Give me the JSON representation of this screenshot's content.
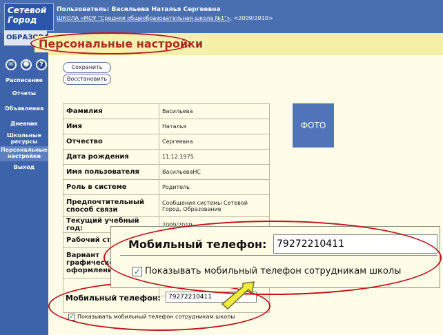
{
  "header": {
    "logo_line1": "Сетевой",
    "logo_line2": "Город",
    "logo_strip": "ОБРАЗОВАНИЕ",
    "user": "Пользователь: Васильева Наталья Сергеевна",
    "school": "ШКОЛА «МОУ \"Средняя общеобразовательная школа №1\"»",
    "year": ", <2009/2010>"
  },
  "page": {
    "title": "Персональные настройки"
  },
  "sidebar": {
    "icons": [
      "mail-icon",
      "users-icon",
      "help-icon"
    ],
    "items": [
      {
        "label": "Расписание"
      },
      {
        "label": "Отчеты"
      },
      {
        "label": "Объявления"
      },
      {
        "label": "Дневник"
      },
      {
        "label": "Школьные ресурсы"
      },
      {
        "label": "Персональные настройки"
      },
      {
        "label": "Выход"
      }
    ]
  },
  "toolbar": {
    "save_label": "Сохранить",
    "restore_label": "Восстановить"
  },
  "form": {
    "rows": [
      {
        "label": "Фамилия",
        "value": "Васильева"
      },
      {
        "label": "Имя",
        "value": "Наталья"
      },
      {
        "label": "Отчество",
        "value": "Сергеевна"
      },
      {
        "label": "Дата рождения",
        "value": "11.12.1975"
      },
      {
        "label": "Имя пользователя",
        "value": "ВасильеваНС"
      },
      {
        "label": "Роль в системе",
        "value": "Родитель"
      },
      {
        "label": "Предпочтительный способ связи",
        "value": "Сообщения системы Сетевой Город. Образование"
      },
      {
        "label": "Текущий учебный год:",
        "value": "2009/2010"
      },
      {
        "label": "Рабочий стол",
        "value": ""
      },
      {
        "label": "Вариант графического оформления:",
        "value": ""
      }
    ],
    "mobile_label": "Мобильный телефон:",
    "mobile_value": "79272210411",
    "show_mobile_label": "Показывать мобильный телефон сотрудникам школы"
  },
  "photo": {
    "label": "ФОТО"
  },
  "zoom": {
    "mobile_label": "Мобильный телефон:",
    "mobile_value": "79272210411",
    "show_mobile_label": "Показывать мобильный телефон сотрудникам школы"
  },
  "colors": {
    "header": "#4a6fb0",
    "sidebar": "#3d64ab",
    "title": "#a8321f",
    "highlight": "#c3111a",
    "arrow": "#f2ea3a"
  }
}
